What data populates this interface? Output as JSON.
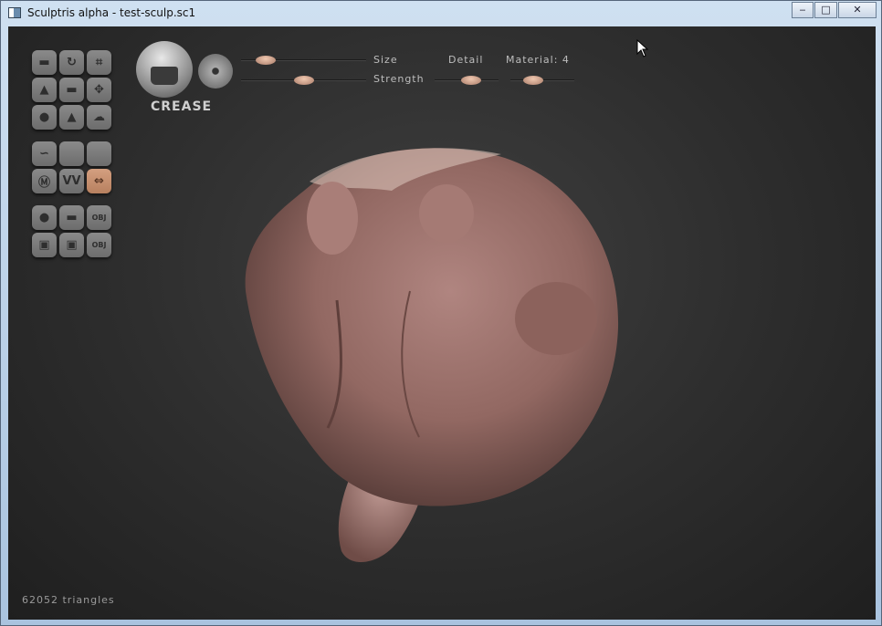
{
  "window": {
    "title": "Sculptris alpha - test-sculp.sc1",
    "minimize": "‒",
    "maximize": "□",
    "close": "✕"
  },
  "toolbar": {
    "brush_name": "CREASE",
    "tools": [
      {
        "name": "crease",
        "glyph": "▬"
      },
      {
        "name": "rotate",
        "glyph": "↻"
      },
      {
        "name": "crop",
        "glyph": "⌗"
      },
      {
        "name": "draw",
        "glyph": "▲"
      },
      {
        "name": "flatten",
        "glyph": "▬"
      },
      {
        "name": "pinch-grab",
        "glyph": "✥"
      },
      {
        "name": "inflate",
        "glyph": "●"
      },
      {
        "name": "pinch",
        "glyph": "▲"
      },
      {
        "name": "smooth",
        "glyph": "☁"
      },
      {
        "name": "stroke",
        "glyph": "∽"
      },
      {
        "name": "empty-1",
        "glyph": ""
      },
      {
        "name": "empty-2",
        "glyph": ""
      },
      {
        "name": "mask",
        "glyph": "Ⓜ"
      },
      {
        "name": "symmetry",
        "glyph": "VV"
      },
      {
        "name": "mirror",
        "glyph": "⇔"
      },
      {
        "name": "sphere",
        "glyph": "●"
      },
      {
        "name": "plane",
        "glyph": "▬"
      },
      {
        "name": "import-obj",
        "glyph": "OBJ"
      },
      {
        "name": "save",
        "glyph": "▣"
      },
      {
        "name": "open",
        "glyph": "▣"
      },
      {
        "name": "export-obj",
        "glyph": "OBJ"
      }
    ],
    "sliders": {
      "size": {
        "label": "Size",
        "value": 0.2
      },
      "strength": {
        "label": "Strength",
        "value": 0.5
      },
      "detail": {
        "label": "Detail",
        "value": 0.57
      },
      "material": {
        "label": "Material: 4",
        "value": 0.36
      }
    }
  },
  "status": {
    "triangles": "62052 triangles"
  },
  "colors": {
    "accent": "#c48f70",
    "clay": "#9a6e68"
  }
}
